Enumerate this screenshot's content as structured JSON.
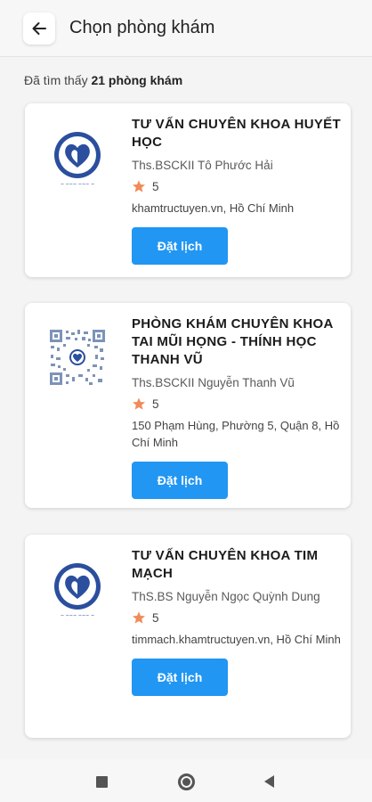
{
  "header": {
    "title": "Chọn phòng khám",
    "back_icon": "arrow-left-icon"
  },
  "summary": {
    "prefix": "Đã tìm thấy ",
    "count_text": "21 phòng khám"
  },
  "clinics": [
    {
      "name": "TƯ VẤN CHUYÊN KHOA HUYẾT HỌC",
      "doctor": "Ths.BSCKII Tô Phước Hải",
      "rating": "5",
      "address": "khamtructuyen.vn, Hồ Chí Minh",
      "button": "Đặt lịch",
      "logo": "heart-logo"
    },
    {
      "name": "PHÒNG KHÁM CHUYÊN KHOA TAI MŨI HỌNG - THÍNH HỌC THANH VŨ",
      "doctor": "Ths.BSCKII Nguyễn Thanh Vũ",
      "rating": "5",
      "address": "150 Phạm Hùng, Phường 5, Quận 8, Hồ Chí Minh",
      "button": "Đặt lịch",
      "logo": "qr-code-logo"
    },
    {
      "name": "TƯ VẤN CHUYÊN KHOA TIM MẠCH",
      "doctor": "ThS.BS Nguyễn Ngọc Quỳnh Dung",
      "rating": "5",
      "address": "timmach.khamtructuyen.vn, Hồ Chí Minh",
      "button": "Đặt lịch",
      "logo": "heart-logo"
    }
  ],
  "colors": {
    "accent": "#2196f3",
    "star": "#f08c5a",
    "logo_blue": "#2b4f9e"
  },
  "system_nav": {
    "icons": [
      "recent-apps-icon",
      "home-icon",
      "back-icon"
    ]
  }
}
